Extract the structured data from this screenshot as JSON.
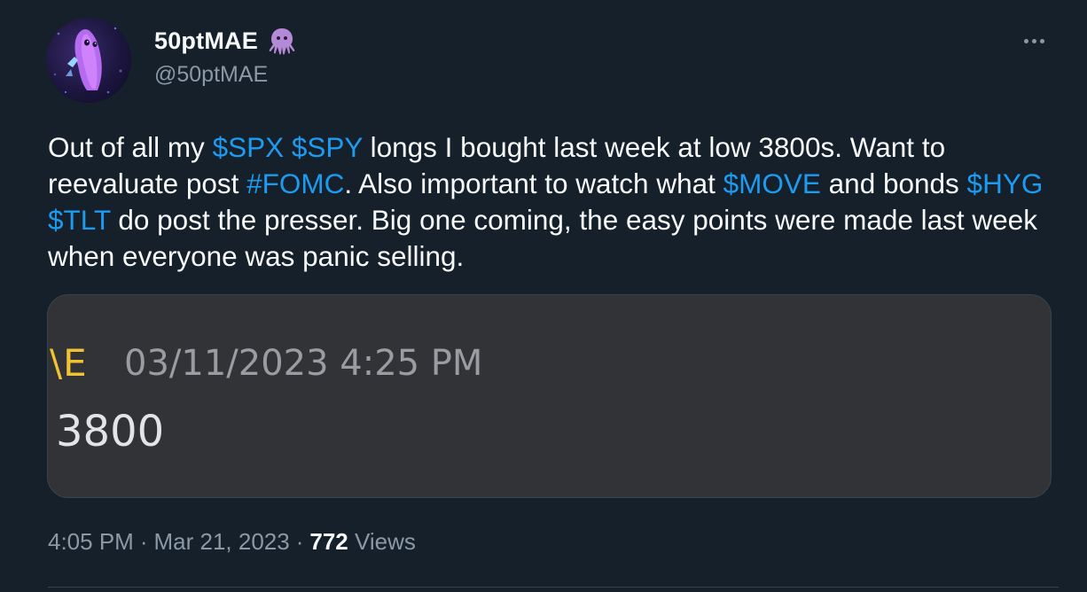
{
  "author": {
    "display_name": "50ptMAE",
    "handle": "@50ptMAE",
    "badge_icon": "octopus-emoji-icon",
    "avatar_icon": "avatar-image"
  },
  "menu": {
    "more_icon": "more-options-icon"
  },
  "tweet": {
    "segments": [
      {
        "text": "Out of all my ",
        "link": false
      },
      {
        "text": "$SPX",
        "link": true
      },
      {
        "text": " ",
        "link": false
      },
      {
        "text": "$SPY",
        "link": true
      },
      {
        "text": " longs I bought last week at low 3800s. Want to reevaluate post ",
        "link": false
      },
      {
        "text": "#FOMC",
        "link": true
      },
      {
        "text": ". Also important to watch what ",
        "link": false
      },
      {
        "text": "$MOVE",
        "link": true
      },
      {
        "text": " and bonds ",
        "link": false
      },
      {
        "text": "$HYG",
        "link": true
      },
      {
        "text": " ",
        "link": false
      },
      {
        "text": "$TLT",
        "link": true
      },
      {
        "text": " do post the presser. Big one coming, the easy points were made last week when everyone was panic selling.",
        "link": false
      }
    ]
  },
  "media": {
    "author_fragment": "\\E",
    "timestamp": "03/11/2023 4:25 PM",
    "message": "3800"
  },
  "meta": {
    "time": "4:05 PM",
    "separator": "·",
    "date": "Mar 21, 2023",
    "views_count": "772",
    "views_label": "Views"
  },
  "colors": {
    "background": "#15202b",
    "link": "#1d9bf0",
    "secondary_text": "#8b98a5",
    "media_background": "#323337",
    "media_author": "#f1c232"
  }
}
